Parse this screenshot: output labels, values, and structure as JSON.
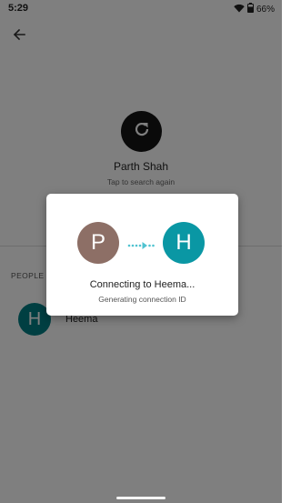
{
  "status_bar": {
    "time": "5:29",
    "battery_percent": "66%",
    "icons": [
      "wifi-icon",
      "battery-icon"
    ]
  },
  "app_bar": {
    "back_icon": "arrow-left-icon"
  },
  "device": {
    "icon": "refresh-icon",
    "name": "Parth Shah",
    "subtitle": "Tap to search again"
  },
  "people_section": {
    "label": "PEOPLE N",
    "items": [
      {
        "initial": "H",
        "name": "Heema",
        "color": "#007f84"
      }
    ]
  },
  "dialog": {
    "sender_initial": "P",
    "sender_color": "#8d6f66",
    "receiver_initial": "H",
    "receiver_color": "#0a97a4",
    "transfer_icon": "dotted-arrow-icon",
    "title": "Connecting to Heema...",
    "status": "Generating connection ID"
  },
  "colors": {
    "scrim": "rgba(0,0,0,0.5)",
    "accent": "#4fc3d0"
  }
}
